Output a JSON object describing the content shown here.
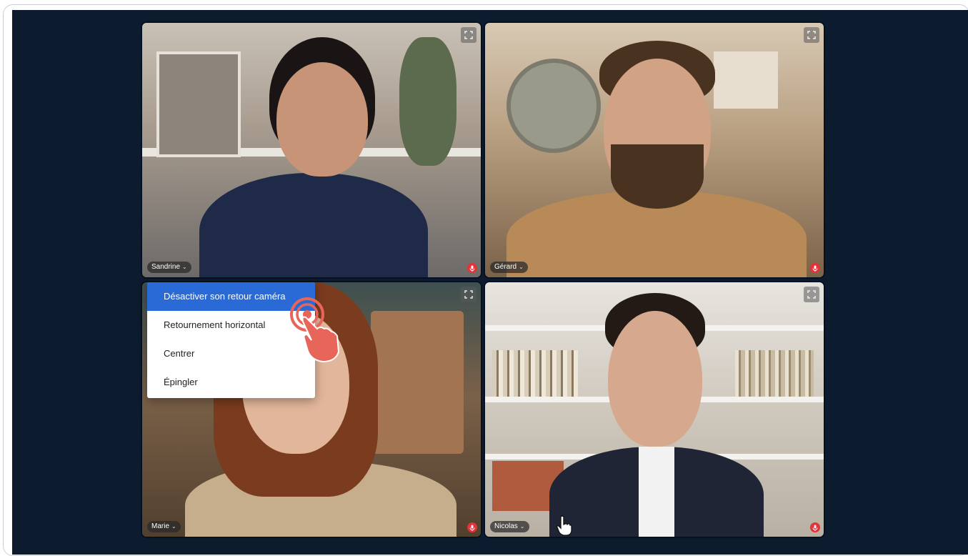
{
  "participants": [
    {
      "name": "Sandrine",
      "chevron": "⌄",
      "mic_muted": true
    },
    {
      "name": "Gérard",
      "chevron": "⌄",
      "mic_muted": true
    },
    {
      "name": "Marie",
      "chevron": "⌄",
      "mic_muted": true
    },
    {
      "name": "Nicolas",
      "chevron": "⌄",
      "mic_muted": true
    }
  ],
  "context_menu": {
    "items": [
      {
        "label": "Désactiver son retour caméra",
        "highlighted": true
      },
      {
        "label": "Retournement horizontal",
        "highlighted": false
      },
      {
        "label": "Centrer",
        "highlighted": false
      },
      {
        "label": "Épingler",
        "highlighted": false
      }
    ]
  },
  "colors": {
    "stage_background": "#0d1b2e",
    "menu_highlight": "#2a6ad6",
    "mic_muted_badge": "#e5323a",
    "tap_indicator": "#e8655a"
  },
  "icons": {
    "expand": "expand-fullscreen-icon",
    "mic_muted": "mic-muted-icon",
    "tap": "tap-hand-icon",
    "cursor": "pointer-hand-cursor-icon"
  }
}
